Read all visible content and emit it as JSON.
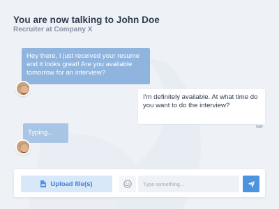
{
  "header": {
    "title": "You are now talking to John Doe",
    "subtitle": "Recruiter at Company X"
  },
  "messages": [
    {
      "text": "Hey there, I just received your resume and it looks great! Are you avaliable tomorrow for an interview?"
    },
    {
      "text": "I'm definitely available. At what time do you want to do the interview?",
      "sender_label": "Me"
    }
  ],
  "typing": {
    "text": "Typing..."
  },
  "composer": {
    "upload_label": "Upload file(s)",
    "placeholder": "Type something..."
  },
  "colors": {
    "accent": "#4c93e0",
    "incoming_bubble": "#8fb4de",
    "typing_bubble": "#a9c5e6",
    "upload_bg": "#d9e8f8",
    "background": "#eef1f6"
  },
  "icons": {
    "upload": "file-icon",
    "emoji": "smiley-icon",
    "send": "paper-plane-icon",
    "avatar": "avatar"
  }
}
